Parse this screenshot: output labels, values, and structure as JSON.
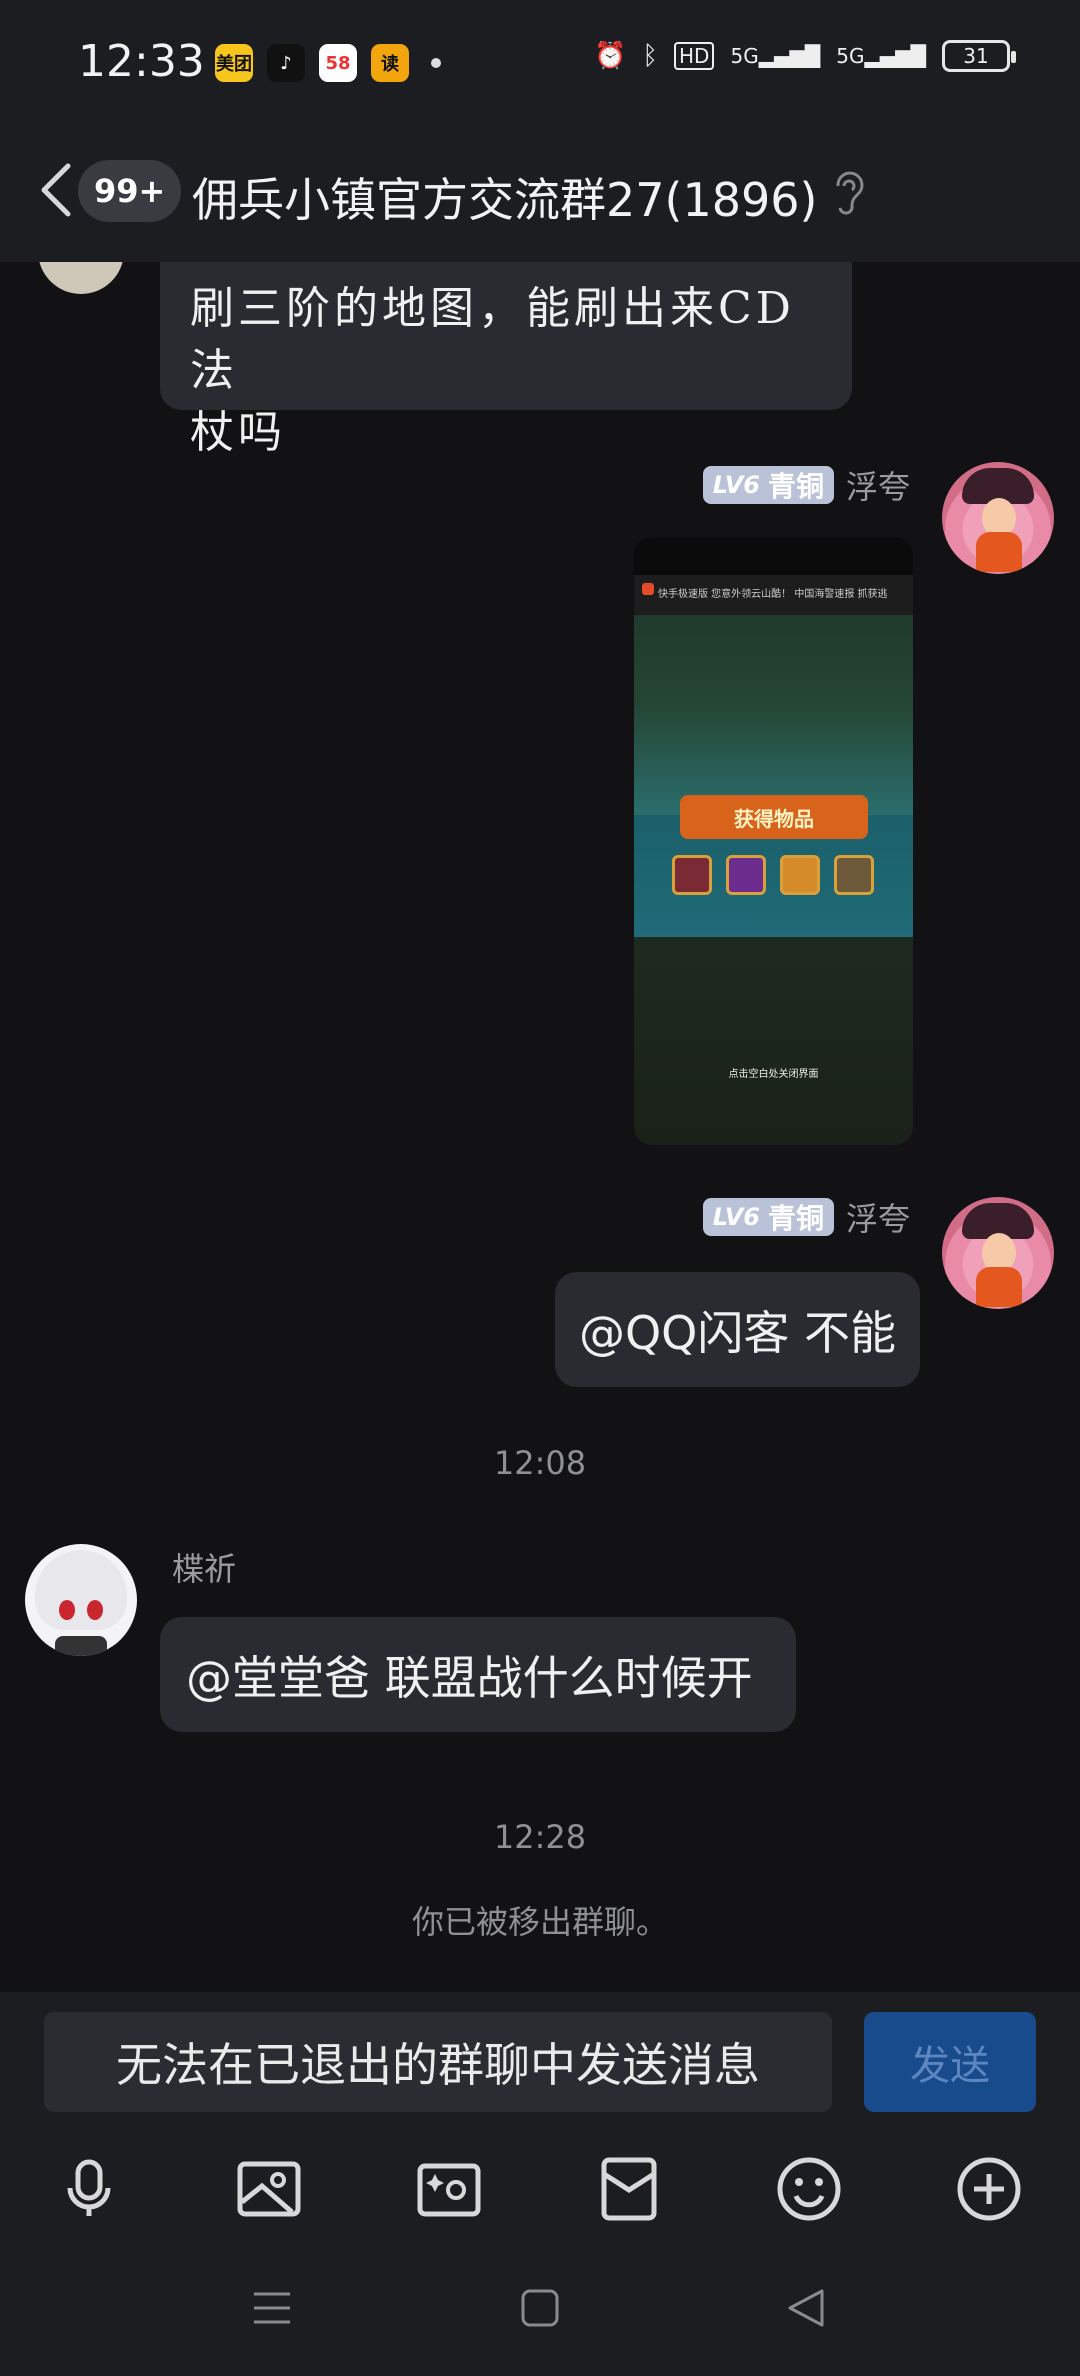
{
  "status_bar": {
    "time": "12:33",
    "apps": [
      {
        "name": "meituan-icon",
        "label": "美团",
        "color": "#f7c51c"
      },
      {
        "name": "douyin-icon",
        "label": "♪",
        "color": "#111111"
      },
      {
        "name": "app-58-icon",
        "label": "58",
        "color": "#ffffff"
      },
      {
        "name": "reader-icon",
        "label": "读",
        "color": "#f2a50c"
      }
    ],
    "battery": "31",
    "hd_label": "HD",
    "network_1": "5G",
    "network_2": "5G"
  },
  "header": {
    "unread_count": "99+",
    "title": "佣兵小镇官方交流群27(1896)"
  },
  "messages": {
    "msg1_text_line1": "刷三阶的地图，能刷出来CD法",
    "msg1_text_line2": "杖吗",
    "sender_badge_level": "LV6",
    "sender_badge_rank": "青铜",
    "sender_name": "浮夸",
    "image_ribbon": "获得物品",
    "image_ad": "快手极速版  您意外领云山酷！ 中国海警速报  抓获逃",
    "image_caption": "点击空白处关闭界面",
    "msg3_text": "@QQ闪客 不能",
    "time_1": "12:08",
    "other_sender": "楪祈",
    "msg4_text": "@堂堂爸 联盟战什么时候开",
    "time_2": "12:28",
    "system_notice": "你已被移出群聊。"
  },
  "input": {
    "placeholder": "无法在已退出的群聊中发送消息",
    "send_label": "发送"
  }
}
